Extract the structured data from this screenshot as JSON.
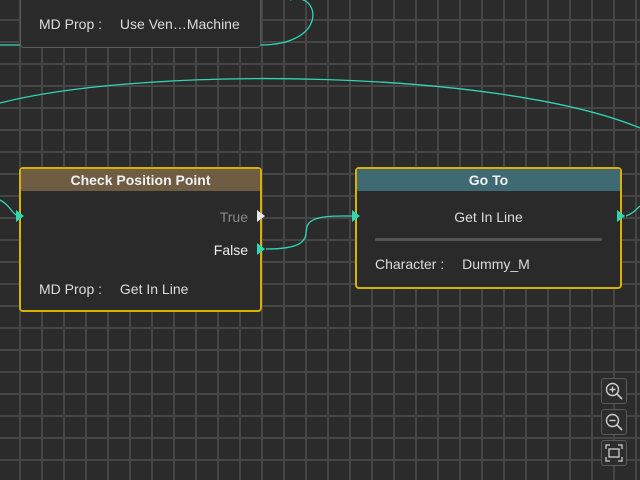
{
  "nodes": {
    "top": {
      "prop_key": "MD Prop :",
      "prop_value": "Use Ven…Machine"
    },
    "check": {
      "title": "Check Position Point",
      "true_label": "True",
      "false_label": "False",
      "prop_key": "MD Prop :",
      "prop_value": "Get In Line"
    },
    "goto": {
      "title": "Go To",
      "subtitle": "Get In Line",
      "prop_key": "Character :",
      "prop_value": "Dummy_M"
    }
  },
  "zoom_controls": {
    "zoom_in_icon": "zoom-in-icon",
    "zoom_out_icon": "zoom-out-icon",
    "fit_icon": "fit-view-icon"
  },
  "colors": {
    "wire": "#2fd6b5",
    "selection": "#d9b100",
    "header_check": "#6e5c43",
    "header_goto": "#3f6a73"
  }
}
